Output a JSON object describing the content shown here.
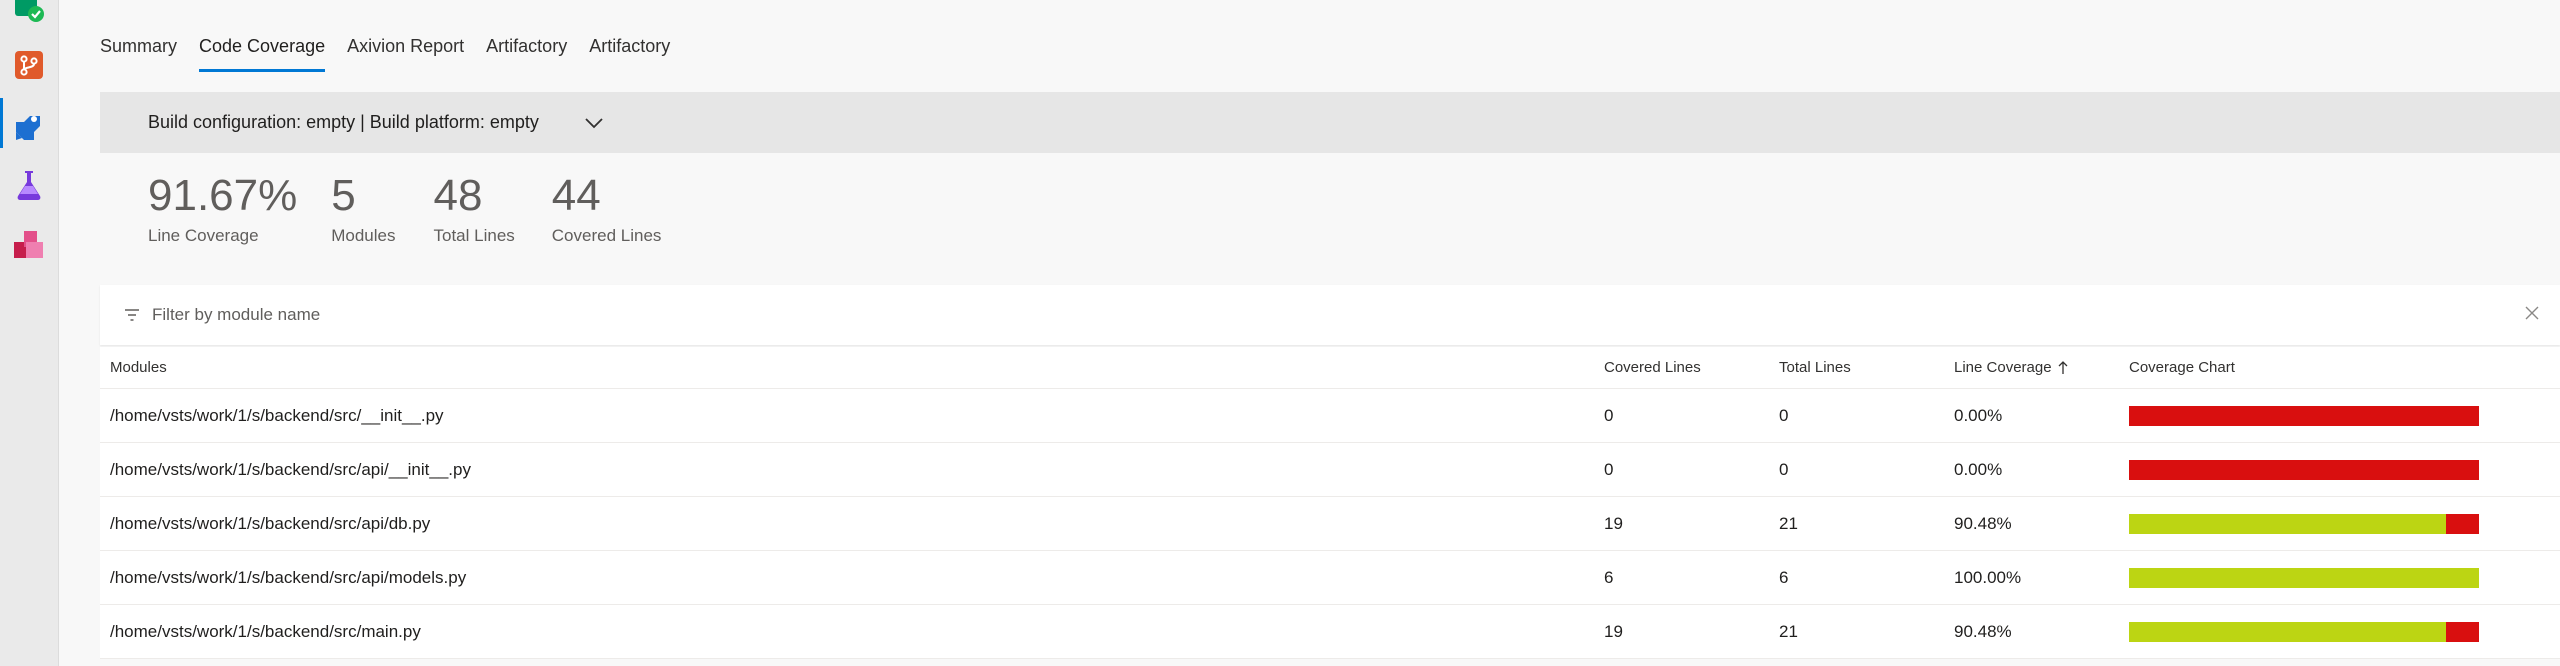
{
  "colors": {
    "accent": "#0078d4",
    "covered": "#bcd513",
    "uncovered": "#d90f0f"
  },
  "rail": {
    "items": [
      {
        "name": "boards",
        "icon": "boards-check-icon"
      },
      {
        "name": "repos",
        "icon": "repos-icon"
      },
      {
        "name": "pipelines",
        "icon": "pipelines-icon",
        "active": true
      },
      {
        "name": "test-plans",
        "icon": "test-plans-icon"
      },
      {
        "name": "artifacts",
        "icon": "artifacts-icon"
      }
    ]
  },
  "tabs": [
    {
      "label": "Summary"
    },
    {
      "label": "Code Coverage",
      "selected": true
    },
    {
      "label": "Axivion Report"
    },
    {
      "label": "Artifactory"
    },
    {
      "label": "Artifactory"
    }
  ],
  "config": {
    "text": "Build configuration: empty | Build platform: empty",
    "chevron_icon": "chevron-down-icon"
  },
  "stats": [
    {
      "value": "91.67%",
      "label": "Line Coverage"
    },
    {
      "value": "5",
      "label": "Modules"
    },
    {
      "value": "48",
      "label": "Total Lines"
    },
    {
      "value": "44",
      "label": "Covered Lines"
    }
  ],
  "filter": {
    "placeholder": "Filter by module name",
    "value": ""
  },
  "table": {
    "headers": {
      "module": "Modules",
      "covered": "Covered Lines",
      "total": "Total Lines",
      "coverage": "Line Coverage",
      "chart": "Coverage Chart"
    },
    "sorted_by": "coverage",
    "sort_direction": "ascending",
    "rows": [
      {
        "module": "/home/vsts/work/1/s/backend/src/__init__.py",
        "covered": "0",
        "total": "0",
        "coverage": "0.00%",
        "fraction": 0.0
      },
      {
        "module": "/home/vsts/work/1/s/backend/src/api/__init__.py",
        "covered": "0",
        "total": "0",
        "coverage": "0.00%",
        "fraction": 0.0
      },
      {
        "module": "/home/vsts/work/1/s/backend/src/api/db.py",
        "covered": "19",
        "total": "21",
        "coverage": "90.48%",
        "fraction": 0.9048
      },
      {
        "module": "/home/vsts/work/1/s/backend/src/api/models.py",
        "covered": "6",
        "total": "6",
        "coverage": "100.00%",
        "fraction": 1.0
      },
      {
        "module": "/home/vsts/work/1/s/backend/src/main.py",
        "covered": "19",
        "total": "21",
        "coverage": "90.48%",
        "fraction": 0.9048
      }
    ]
  }
}
